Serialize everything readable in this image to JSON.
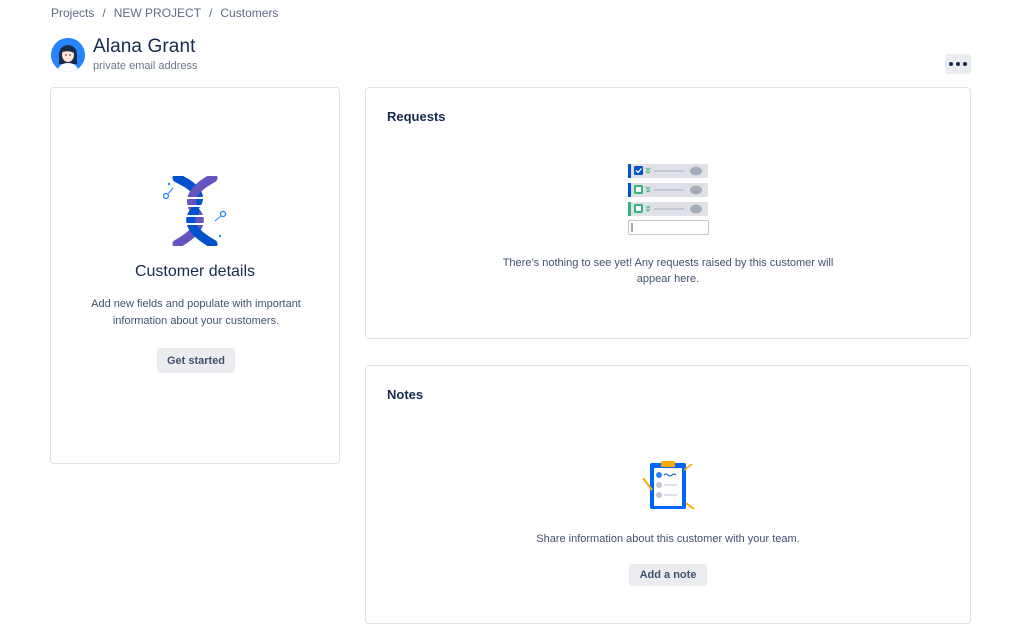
{
  "breadcrumb": {
    "items": [
      "Projects",
      "NEW PROJECT",
      "Customers"
    ],
    "separator": "/"
  },
  "customer": {
    "name": "Alana Grant",
    "email_label": "private email address",
    "avatar_icon": "person-avatar-icon"
  },
  "actions": {
    "more_icon": "more-horizontal-icon"
  },
  "details_card": {
    "icon": "dna-icon",
    "title": "Customer details",
    "description": "Add new fields and populate with important information about your customers.",
    "button_label": "Get started"
  },
  "requests_card": {
    "heading": "Requests",
    "icon": "checklist-icon",
    "empty_text": "There’s nothing to see yet! Any requests raised by this customer will appear here."
  },
  "notes_card": {
    "heading": "Notes",
    "icon": "clipboard-icon",
    "empty_text": "Share information about this customer with your team.",
    "button_label": "Add a note"
  },
  "colors": {
    "text_primary": "#172b4d",
    "text_secondary": "#42526e",
    "button_bg": "#ebecf0",
    "border": "#dfe1e6",
    "accent_blue": "#0052cc",
    "accent_green": "#36b37e",
    "accent_purple": "#6554c0",
    "accent_yellow": "#ffab00"
  }
}
